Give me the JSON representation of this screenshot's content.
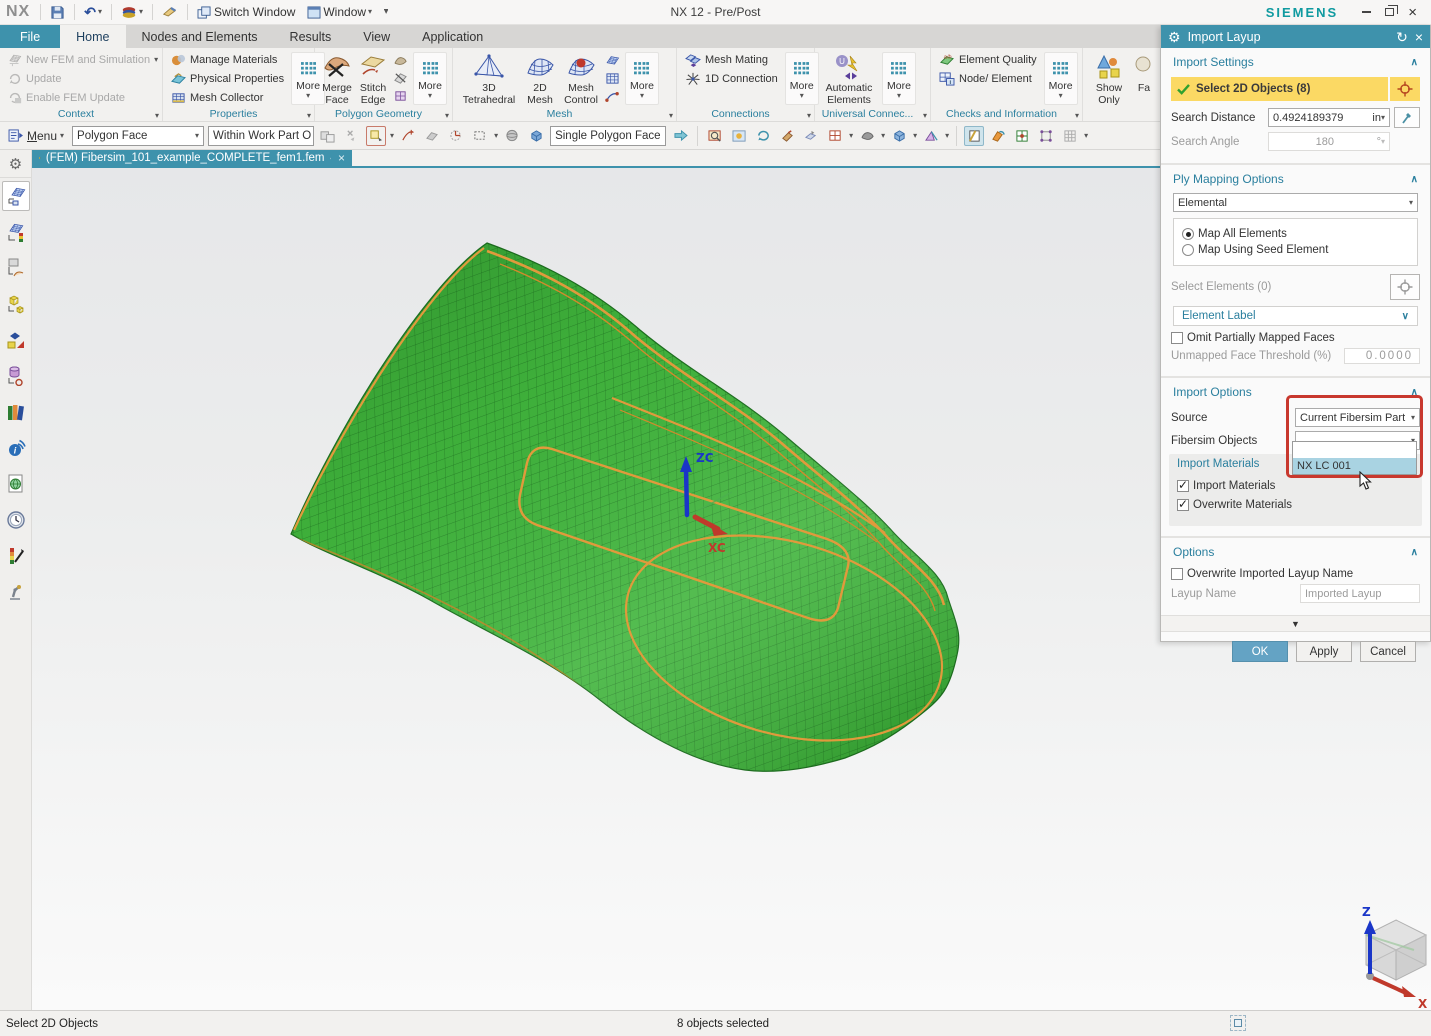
{
  "titlebar": {
    "logo": "NX",
    "title": "NX 12 - Pre/Post",
    "brand": "SIEMENS",
    "switch_window": "Switch Window",
    "window_menu": "Window"
  },
  "ribbon_tabs": {
    "items": [
      {
        "label": "File"
      },
      {
        "label": "Home"
      },
      {
        "label": "Nodes and Elements"
      },
      {
        "label": "Results"
      },
      {
        "label": "View"
      },
      {
        "label": "Application"
      }
    ],
    "active": "Home"
  },
  "ribbon": {
    "context": {
      "label": "Context",
      "items": [
        {
          "label": "New FEM and Simulation"
        },
        {
          "label": "Update"
        },
        {
          "label": "Enable FEM Update"
        }
      ]
    },
    "properties": {
      "label": "Properties",
      "more": "More",
      "items": [
        {
          "label": "Manage Materials"
        },
        {
          "label": "Physical Properties"
        },
        {
          "label": "Mesh Collector"
        }
      ]
    },
    "polygon_geometry": {
      "label": "Polygon Geometry",
      "more": "More",
      "items": [
        {
          "label": "Merge Face"
        },
        {
          "label": "Stitch Edge"
        }
      ]
    },
    "mesh": {
      "label": "Mesh",
      "more": "More",
      "items": [
        {
          "label": "3D Tetrahedral"
        },
        {
          "label": "2D Mesh"
        },
        {
          "label": "Mesh Control"
        }
      ]
    },
    "connections": {
      "label": "Connections",
      "more": "More",
      "items": [
        {
          "label": "Mesh Mating"
        },
        {
          "label": "1D Connection"
        }
      ]
    },
    "universal": {
      "label": "Universal Connec...",
      "more": "More",
      "items": [
        {
          "label": "Automatic Elements"
        }
      ]
    },
    "checks": {
      "label": "Checks and Information",
      "more": "More",
      "items": [
        {
          "label": "Element Quality"
        },
        {
          "label": "Node/ Element"
        }
      ]
    },
    "view_group": {
      "items": [
        {
          "label": "Show Only"
        },
        {
          "label": "Fa"
        }
      ]
    }
  },
  "selection_bar": {
    "menu": "Menu",
    "type_filter": "Polygon Face",
    "scope": "Within Work Part O",
    "snap": "Single Polygon Face"
  },
  "document_tab": {
    "label": "(FEM) Fibersim_101_example_COMPLETE_fem1.fem"
  },
  "dialog": {
    "title": "Import Layup",
    "import_settings": {
      "heading": "Import Settings",
      "select_objects": "Select 2D Objects (8)",
      "search_distance_label": "Search Distance",
      "search_distance_value": "0.4924189379",
      "search_distance_unit": "in",
      "search_angle_label": "Search Angle",
      "search_angle_value": "180",
      "search_angle_unit": "°"
    },
    "ply_mapping": {
      "heading": "Ply Mapping Options",
      "mode": "Elemental",
      "radio_all": "Map All Elements",
      "radio_seed": "Map Using Seed Element",
      "select_elements": "Select Elements (0)",
      "element_label": "Element Label",
      "omit_faces": "Omit Partially Mapped Faces",
      "threshold_label": "Unmapped Face Threshold (%)",
      "threshold_value": "0.0000"
    },
    "import_options": {
      "heading": "Import Options",
      "source_label": "Source",
      "source_value": "Current Fibersim Part",
      "fibersim_label": "Fibersim Objects",
      "fibersim_value": "",
      "dropdown_blank": "",
      "dropdown_item": "NX LC 001",
      "group_label": "Import Materials",
      "import_materials": "Import Materials",
      "overwrite_materials": "Overwrite Materials"
    },
    "options": {
      "heading": "Options",
      "overwrite_name": "Overwrite Imported Layup Name",
      "layup_name_label": "Layup Name",
      "layup_name_value": "Imported Layup"
    },
    "buttons": {
      "ok": "OK",
      "apply": "Apply",
      "cancel": "Cancel"
    }
  },
  "statusbar": {
    "prompt": "Select 2D Objects",
    "selection": "8 objects selected"
  },
  "viewport": {
    "csys": {
      "z": "ZC",
      "x": "XC"
    },
    "triad": {
      "z": "Z",
      "x": "X"
    }
  },
  "colors": {
    "accent": "#3e92ac",
    "brand_teal": "#0f9aa0",
    "selection_yellow": "#fbd964",
    "highlight_red": "#c8382e",
    "mesh_green": "#41b53d",
    "contour_orange": "#e09a3c",
    "ok_button": "#64a3c4",
    "list_selection": "#a9d3e2"
  }
}
